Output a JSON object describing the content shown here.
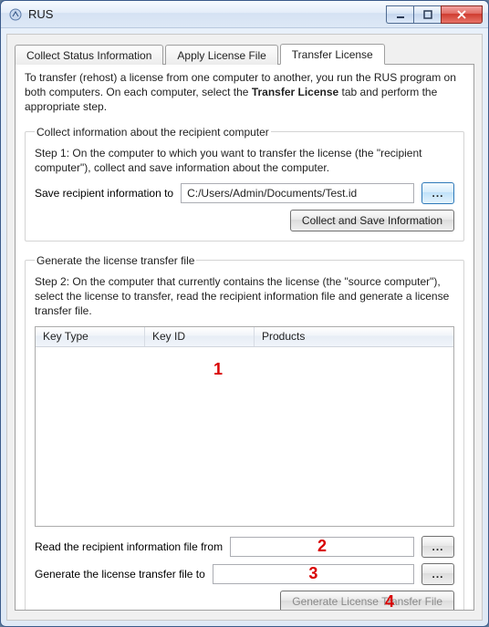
{
  "window": {
    "title": "RUS"
  },
  "tabs": {
    "t1": "Collect Status Information",
    "t2": "Apply License File",
    "t3": "Transfer License"
  },
  "intro": {
    "pre": "To transfer (rehost) a license from one computer to another, you run the RUS program on both computers. On each computer, select the ",
    "bold": "Transfer License",
    "post": " tab and perform the appropriate step."
  },
  "group1": {
    "legend": "Collect information about the recipient computer",
    "step": "Step 1: On the computer to which you want to transfer the license (the \"recipient computer\"), collect and save information about the computer.",
    "saveLabel": "Save recipient information to",
    "savePath": "C:/Users/Admin/Documents/Test.id",
    "browse": "...",
    "collectBtn": "Collect and Save Information"
  },
  "group2": {
    "legend": "Generate the license transfer file",
    "step": "Step 2: On the computer that currently contains the license (the \"source computer\"), select the license to transfer, read the recipient information file and generate a license transfer file.",
    "col1": "Key Type",
    "col2": "Key ID",
    "col3": "Products",
    "readLabel": "Read the recipient information file from",
    "readPath": "",
    "genLabel": "Generate the license transfer file to",
    "genPath": "",
    "browse": "...",
    "genBtn": "Generate License Transfer File"
  },
  "annotations": {
    "a1": "1",
    "a2": "2",
    "a3": "3",
    "a4": "4"
  }
}
